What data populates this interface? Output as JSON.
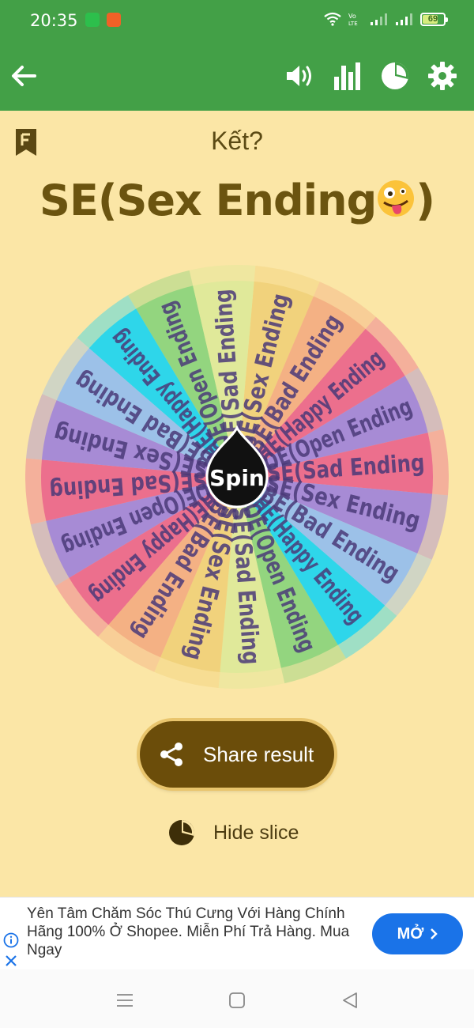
{
  "status_bar": {
    "time": "20:35",
    "battery": "69",
    "app_icons": [
      "wechat-icon",
      "shopee-icon"
    ],
    "indicators": [
      "wifi-icon",
      "volte-icon",
      "signal-icon",
      "signal-icon"
    ]
  },
  "toolbar": {
    "back": "back-arrow-icon",
    "actions": [
      "volume-icon",
      "stats-icon",
      "pie-chart-icon",
      "settings-icon"
    ]
  },
  "question": "Kết?",
  "result": "SE(Sex Ending",
  "result_emoji": "zany-face-emoji",
  "wheel": {
    "center_label": "Spin",
    "slices": [
      {
        "label": "SE(Sex Ending",
        "color": "#f1d27c"
      },
      {
        "label": "BE(Bad Ending",
        "color": "#f4b184"
      },
      {
        "label": "HE(Happy Ending",
        "color": "#ec6f8d"
      },
      {
        "label": "OE(Open Ending",
        "color": "#a78bd5"
      },
      {
        "label": "SE(Sad Ending",
        "color": "#ec6f8d"
      },
      {
        "label": "SE(Sex Ending",
        "color": "#a78bd5"
      },
      {
        "label": "BE(Bad Ending",
        "color": "#9cc1e8"
      },
      {
        "label": "HE(Happy Ending",
        "color": "#2ed6ea"
      },
      {
        "label": "OE(Open Ending",
        "color": "#93d57f"
      },
      {
        "label": "SE(Sad Ending",
        "color": "#e0e99a"
      },
      {
        "label": "SE(Sex Ending",
        "color": "#f1d27c"
      },
      {
        "label": "BE(Bad Ending",
        "color": "#f4b184"
      },
      {
        "label": "HE(Happy Ending",
        "color": "#ec6f8d"
      },
      {
        "label": "OE(Open Ending",
        "color": "#a78bd5"
      },
      {
        "label": "SE(Sad Ending",
        "color": "#ec6f8d"
      },
      {
        "label": "SE(Sex Ending",
        "color": "#a78bd5"
      },
      {
        "label": "BE(Bad Ending",
        "color": "#9cc1e8"
      },
      {
        "label": "HE(Happy Ending",
        "color": "#2ed6ea"
      },
      {
        "label": "OE(Open Ending",
        "color": "#93d57f"
      },
      {
        "label": "SE(Sad Ending",
        "color": "#e0e99a"
      }
    ]
  },
  "share_button": {
    "label": "Share result"
  },
  "hide_slice": {
    "label": "Hide slice"
  },
  "ad": {
    "text": "Yên Tâm Chăm Sóc Thú Cưng Với Hàng Chính Hãng 100% Ở Shopee. Miễn Phí Trả Hàng. Mua Ngay",
    "button": "MỞ"
  },
  "colors": {
    "toolbar": "#43a047",
    "background": "#fbe6a6",
    "button": "#6b4d0a",
    "title_text": "#6b5410",
    "ad_button": "#1a73e8"
  }
}
